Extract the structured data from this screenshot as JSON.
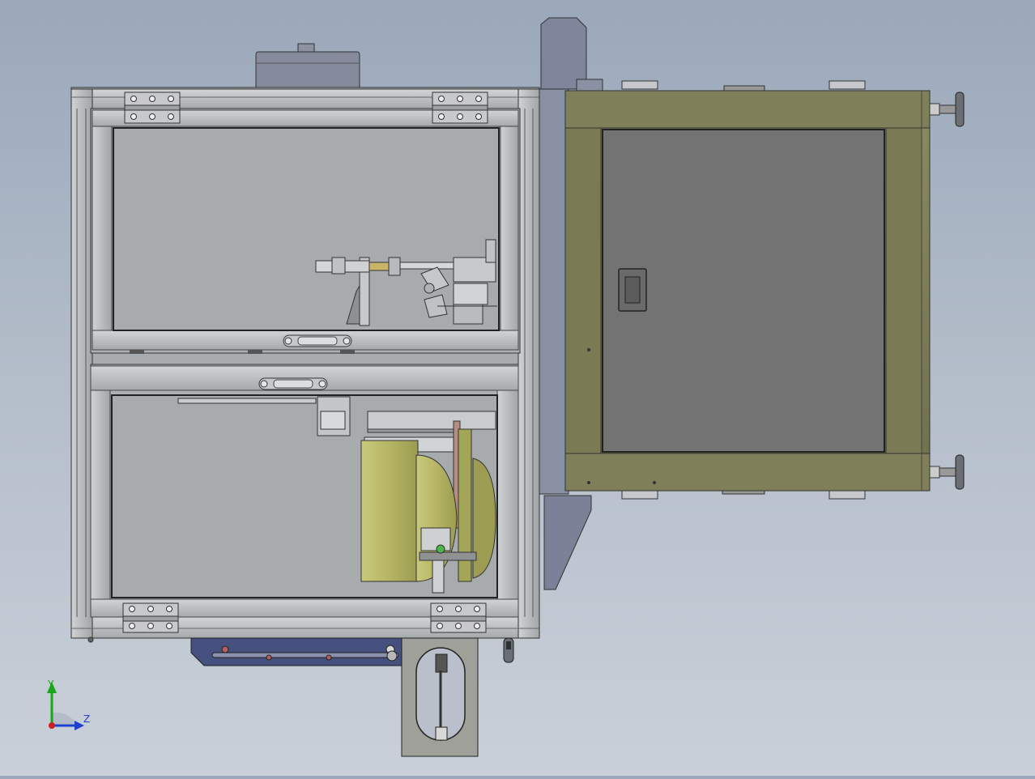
{
  "viewport": {
    "background_top": "#9aa8ba",
    "background_bottom": "#c9d0d9",
    "render_style": "shaded-with-edges",
    "view_orientation": "top"
  },
  "model": {
    "left_cabinet": {
      "frame_color": "#b9bcbf",
      "glass_color": "#a9acaf",
      "hinge_count": 4,
      "handle_count": 2
    },
    "right_cabinet": {
      "frame_color": "#7d7e5a",
      "panel_color": "#737373",
      "leveling_feet_count": 2,
      "latch": "latch-icon"
    },
    "parts": {
      "yellow_drum_color": "#b8b86a",
      "blue_bracket_color": "#45507e",
      "side_column_color": "#7f869c"
    }
  },
  "triad": {
    "y_label": "Y",
    "z_label": "Z",
    "y_color": "#1aa51a",
    "z_color": "#1f3fd0",
    "origin_color": "#cc1f1f"
  }
}
